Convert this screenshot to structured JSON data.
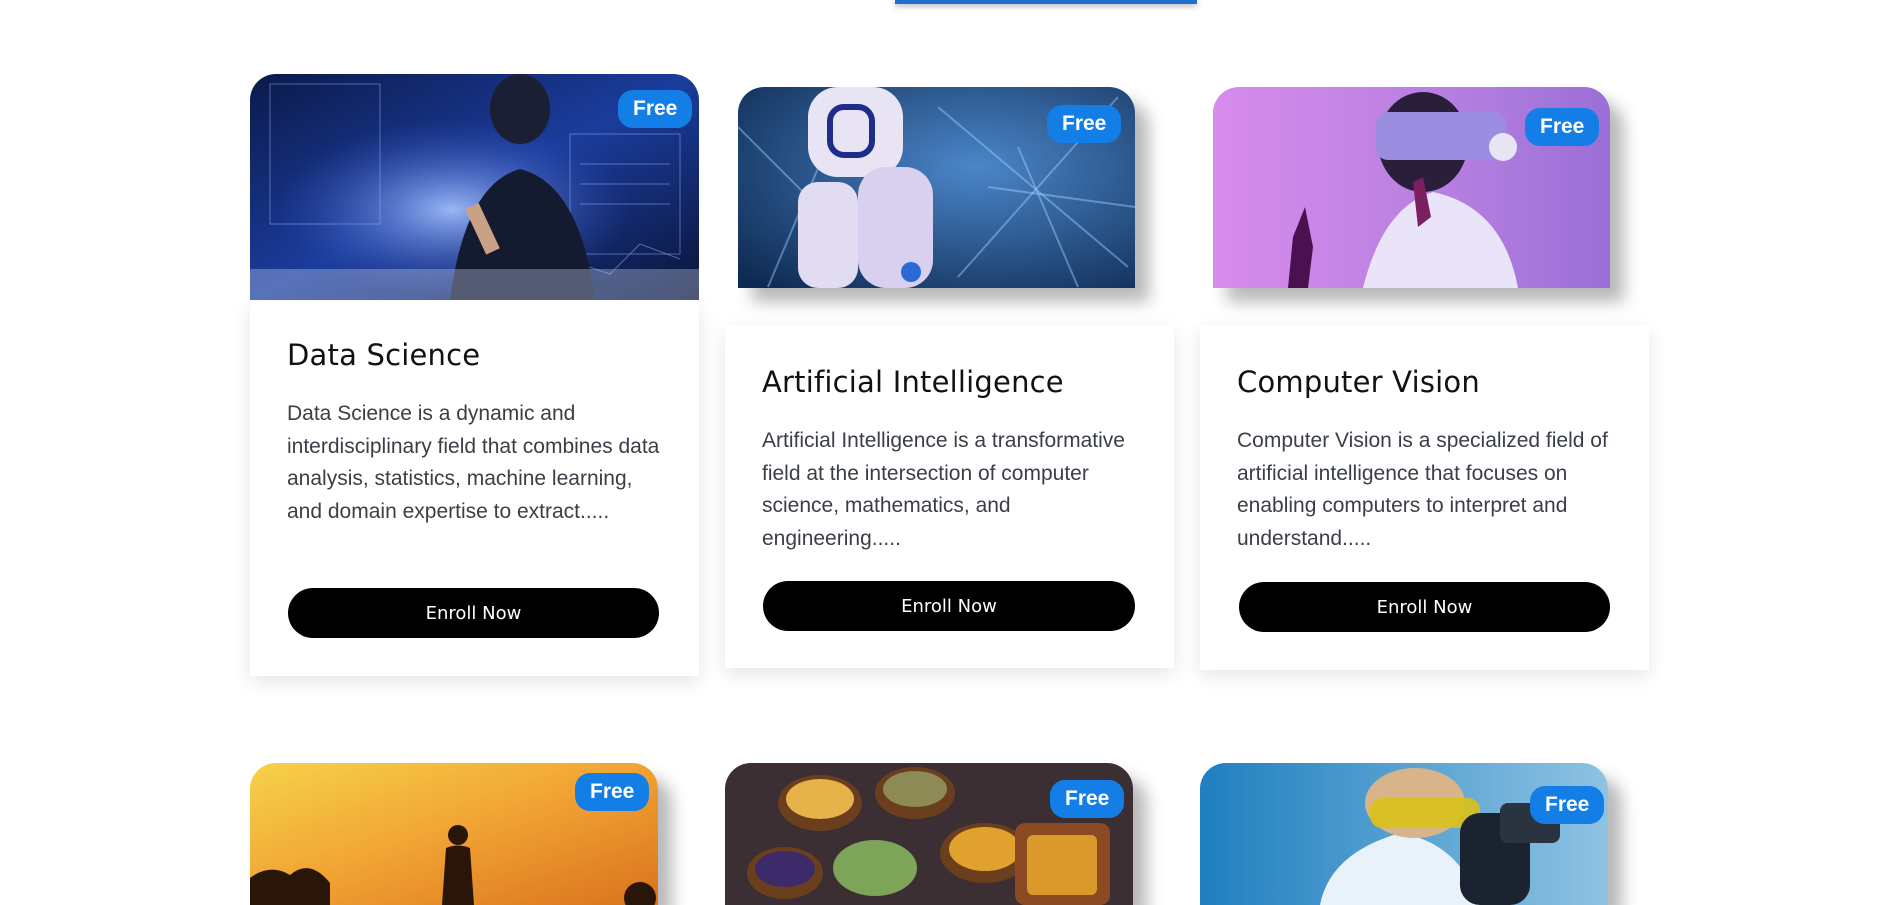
{
  "courses": [
    {
      "badge": "Free",
      "title": "Data Science",
      "description": "Data Science is a dynamic and interdisciplinary field that combines data analysis, statistics, machine learning, and domain expertise to extract.....",
      "button": "Enroll Now",
      "image": "person-with-holographic-data-screens"
    },
    {
      "badge": "Free",
      "title": "Artificial Intelligence",
      "description": "Artificial Intelligence is a transformative field at the intersection of computer science, mathematics, and engineering.....",
      "button": "Enroll Now",
      "image": "white-robot-with-neural-network-background"
    },
    {
      "badge": "Free",
      "title": "Computer Vision",
      "description": "Computer Vision is a specialized field of artificial intelligence that focuses on enabling computers to interpret and understand.....",
      "button": "Enroll Now",
      "image": "woman-wearing-vr-headset-purple"
    },
    {
      "badge": "Free",
      "image": "yoga-silhouette-at-sunset"
    },
    {
      "badge": "Free",
      "image": "herbs-and-spices-in-bowls"
    },
    {
      "badge": "Free",
      "image": "scientist-with-microscope"
    }
  ],
  "colors": {
    "badge": "#137ee6",
    "button": "#000000",
    "title": "#111111",
    "description": "#3a3f47"
  }
}
